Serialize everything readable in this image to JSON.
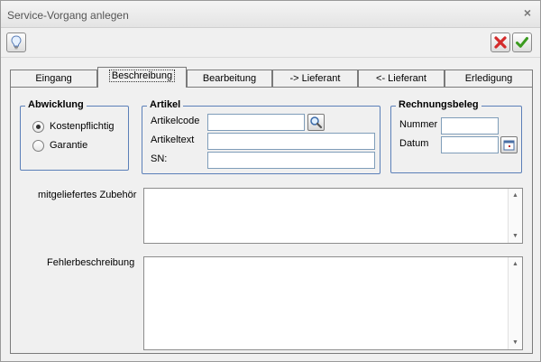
{
  "window": {
    "title": "Service-Vorgang anlegen",
    "close_glyph": "×"
  },
  "toolbar": {
    "hint_icon": "lightbulb-icon",
    "cancel_icon": "red-x-icon",
    "ok_icon": "green-check-icon"
  },
  "tabs": [
    {
      "label": "Eingang",
      "active": false
    },
    {
      "label": "Beschreibung",
      "active": true
    },
    {
      "label": "Bearbeitung",
      "active": false
    },
    {
      "label": "-> Lieferant",
      "active": false
    },
    {
      "label": "<- Lieferant",
      "active": false
    },
    {
      "label": "Erledigung",
      "active": false
    }
  ],
  "abwicklung": {
    "title": "Abwicklung",
    "options": [
      {
        "label": "Kostenpflichtig",
        "checked": true
      },
      {
        "label": "Garantie",
        "checked": false
      }
    ]
  },
  "artikel": {
    "title": "Artikel",
    "code_label": "Artikelcode",
    "code_value": "",
    "text_label": "Artikeltext",
    "text_value": "",
    "sn_label": "SN:",
    "sn_value": "",
    "search_icon": "magnifier-icon"
  },
  "rechnungsbeleg": {
    "title": "Rechnungsbeleg",
    "nummer_label": "Nummer",
    "nummer_value": "",
    "datum_label": "Datum",
    "datum_value": "",
    "calendar_icon": "calendar-icon"
  },
  "zubehoer": {
    "label": "mitgeliefertes Zubehör",
    "value": ""
  },
  "fehler": {
    "label": "Fehlerbeschreibung",
    "value": ""
  },
  "colors": {
    "groupbox_border": "#5b7fb8",
    "input_border": "#7f9db9",
    "cancel_red": "#d42b2b",
    "ok_green": "#3a9a1e"
  }
}
